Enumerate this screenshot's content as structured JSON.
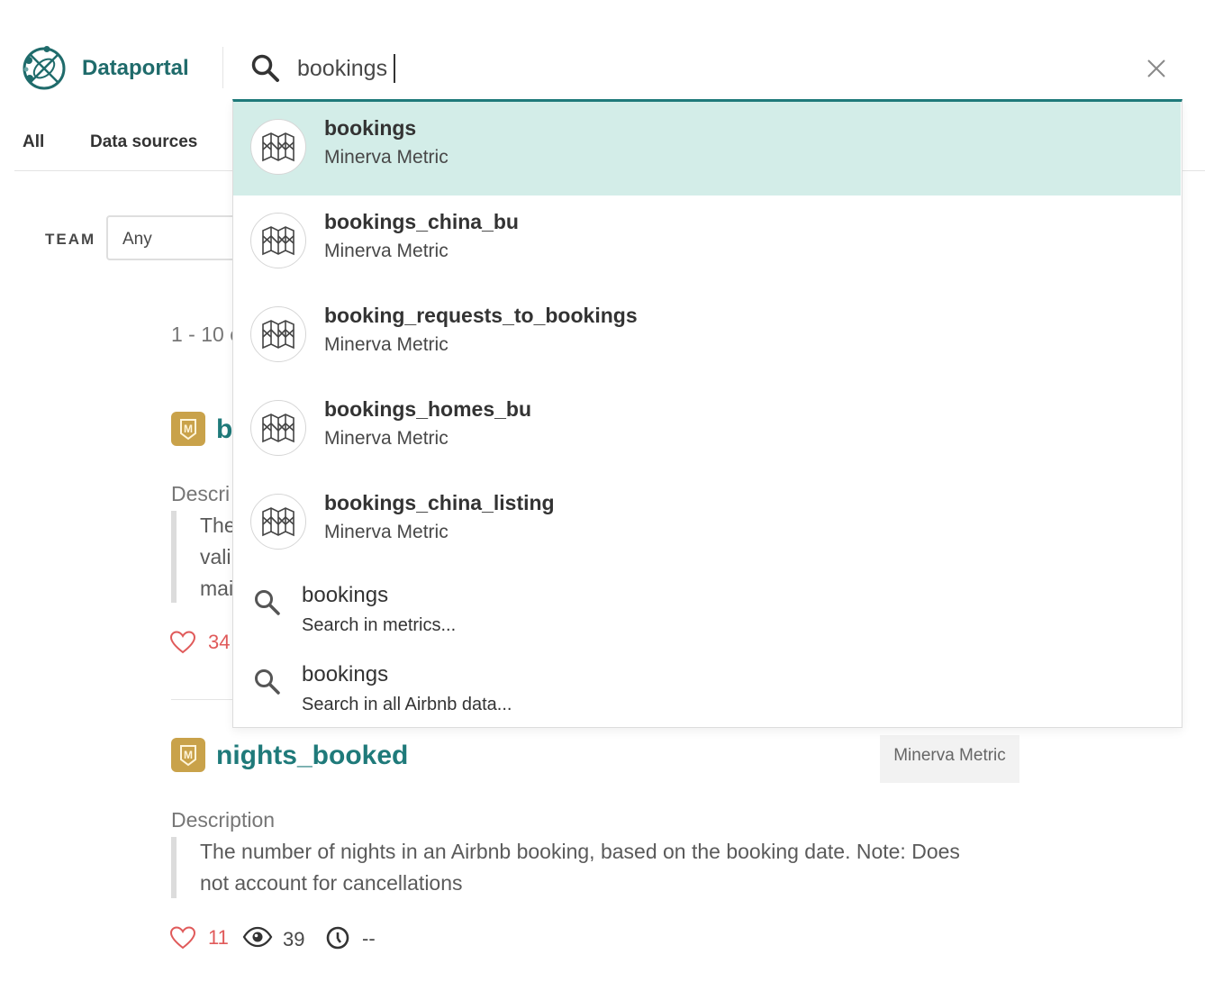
{
  "app": {
    "brand": "Dataportal"
  },
  "search": {
    "query": "bookings"
  },
  "nav": {
    "tabs": [
      "All",
      "Data sources"
    ]
  },
  "filter": {
    "label": "TEAM",
    "value": "Any"
  },
  "results": {
    "count_text": "1 - 10 c",
    "items": [
      {
        "title_partial": "b",
        "desc_label": "Descri",
        "desc_lines": [
          "The",
          "vali",
          "mai"
        ],
        "likes": "34"
      },
      {
        "title": "nights_booked",
        "tag": "Minerva Metric",
        "desc_label": "Description",
        "desc_lines": [
          "The number of nights in an Airbnb booking, based on the booking date. Note: Does",
          "not account for cancellations"
        ],
        "likes": "11",
        "views": "39",
        "last_updated": "--"
      }
    ]
  },
  "dropdown": {
    "suggestions": [
      {
        "name": "bookings",
        "type": "Minerva Metric",
        "icon": "minerva-metric-icon"
      },
      {
        "name": "bookings_china_bu",
        "type": "Minerva Metric",
        "icon": "minerva-metric-icon"
      },
      {
        "name": "booking_requests_to_bookings",
        "type": "Minerva Metric",
        "icon": "minerva-metric-icon"
      },
      {
        "name": "bookings_homes_bu",
        "type": "Minerva Metric",
        "icon": "minerva-metric-icon"
      },
      {
        "name": "bookings_china_listing",
        "type": "Minerva Metric",
        "icon": "minerva-metric-icon"
      }
    ],
    "search_options": [
      {
        "term": "bookings",
        "hint": "Search in metrics..."
      },
      {
        "term": "bookings",
        "hint": "Search in all Airbnb data..."
      }
    ]
  },
  "colors": {
    "accent": "#1f7a7a",
    "highlight": "#d3ede8",
    "like": "#e05a5a",
    "badge": "#c9a24a"
  }
}
